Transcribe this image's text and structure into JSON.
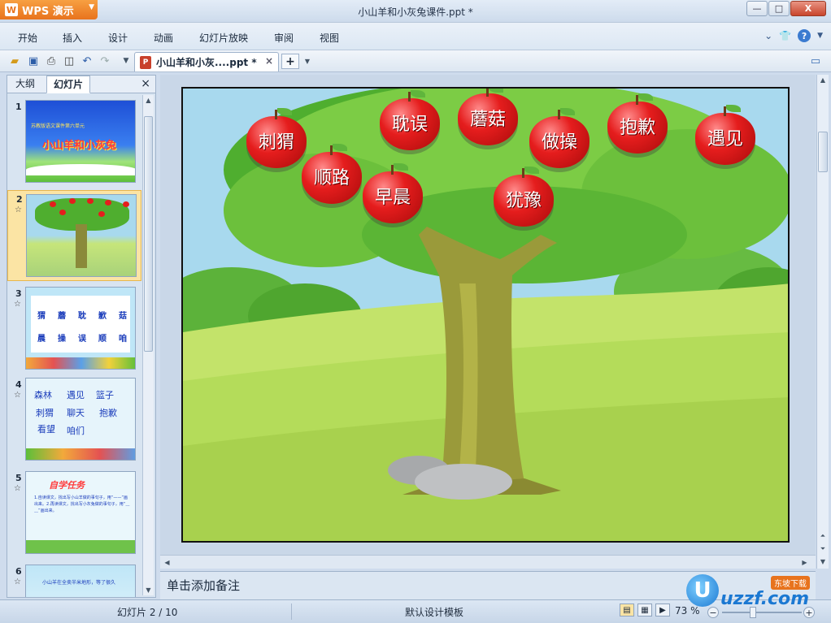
{
  "window": {
    "app_button": "WPS 演示",
    "title": "小山羊和小灰兔课件.ppt *",
    "minimize": "—",
    "maximize": "□",
    "close": "X"
  },
  "menu": {
    "items": [
      "开始",
      "插入",
      "设计",
      "动画",
      "幻灯片放映",
      "审阅",
      "视图"
    ]
  },
  "toolbar": {
    "doc_tab_label": "小山羊和小灰....ppt *",
    "new_tab": "+"
  },
  "left_panel": {
    "tabs": [
      "大纲",
      "幻灯片"
    ],
    "close": "×",
    "slides": [
      {
        "num": "1",
        "title": "小山羊和小灰兔",
        "subtitle": "苏教版语文课件第六单元"
      },
      {
        "num": "2"
      },
      {
        "num": "3",
        "words": [
          "猬",
          "蘑",
          "耽",
          "歉",
          "菇",
          "晨",
          "操",
          "误",
          "顺",
          "咱"
        ]
      },
      {
        "num": "4",
        "words": [
          "森林",
          "遇见",
          "篮子",
          "刺猬",
          "聊天",
          "抱歉",
          "看望",
          "咱们"
        ]
      },
      {
        "num": "5",
        "heading": "自学任务",
        "text": "1.自读课文，找出写小山羊做的事句子，用“——”画出来。2.再读课文，找出写小灰兔做的事句子，用“﹏﹏”画出来。"
      },
      {
        "num": "6",
        "text": "小山羊在全卖半米地形，等了很久"
      }
    ]
  },
  "slide": {
    "apples": [
      "刺猬",
      "顺路",
      "早晨",
      "耽误",
      "蘑菇",
      "做操",
      "犹豫",
      "抱歉",
      "遇见"
    ]
  },
  "notes": {
    "placeholder": "单击添加备注"
  },
  "status": {
    "slide_counter": "幻灯片 2 / 10",
    "template": "默认设计模板",
    "zoom": "73 %"
  },
  "watermark": {
    "text": "uzzf.com",
    "badge": "东坡下载"
  },
  "colors": {
    "accent_orange": "#e8731d",
    "apple_red": "#e51d1d",
    "sky": "#a8d9ee",
    "grass": "#b4dc5a"
  }
}
